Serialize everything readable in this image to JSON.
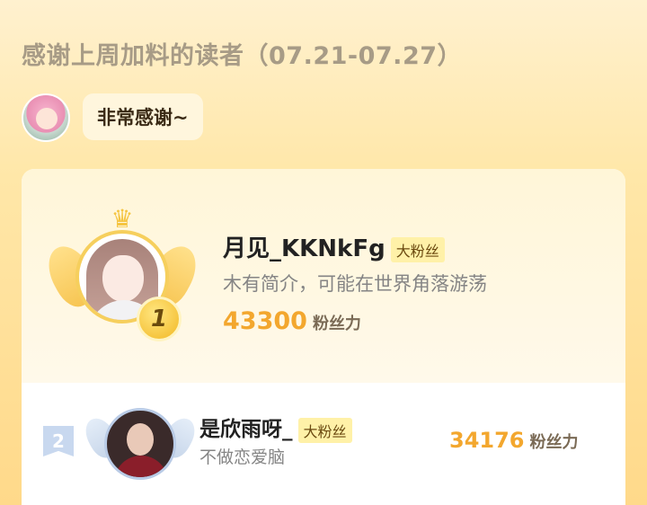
{
  "header": {
    "title": "感谢上周加料的读者（07.21-07.27）"
  },
  "greeting": {
    "text": "非常感谢~"
  },
  "leaderboard": [
    {
      "rank": "1",
      "name": "月见_KKNkFg",
      "tag": "大粉丝",
      "bio": "木有简介，可能在世界角落游荡",
      "score": "43300",
      "score_unit": "粉丝力"
    },
    {
      "rank": "2",
      "name": "是欣雨呀_",
      "tag": "大粉丝",
      "bio": "不做恋爱脑",
      "score": "34176",
      "score_unit": "粉丝力"
    }
  ],
  "colors": {
    "accent": "#f3a72e",
    "tag_bg": "#fff1a8",
    "rank2": "#c8d8ef"
  },
  "icons": {
    "first_place": "crown-icon",
    "second_place": "rank-ribbon-icon"
  }
}
